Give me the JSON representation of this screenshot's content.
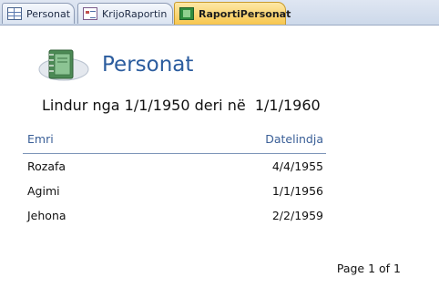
{
  "tabs": [
    {
      "label": "Personat",
      "icon": "table-icon",
      "active": false
    },
    {
      "label": "KrijoRaportin",
      "icon": "form-icon",
      "active": false
    },
    {
      "label": "RaportiPersonat",
      "icon": "report-icon",
      "active": true
    }
  ],
  "report": {
    "icon": "address-book-icon",
    "title": "Personat",
    "subtitle": "Lindur nga 1/1/1950 deri në  1/1/1960",
    "columns": {
      "name": "Emri",
      "birthdate": "Datelindja"
    },
    "rows": [
      {
        "name": "Rozafa",
        "birthdate": "4/4/1955"
      },
      {
        "name": "Agimi",
        "birthdate": "1/1/1956"
      },
      {
        "name": "Jehona",
        "birthdate": "2/2/1959"
      }
    ],
    "footer": "Page 1 of 1"
  },
  "colors": {
    "accent": "#2b5c9e",
    "active_tab": "#f7c64e"
  }
}
